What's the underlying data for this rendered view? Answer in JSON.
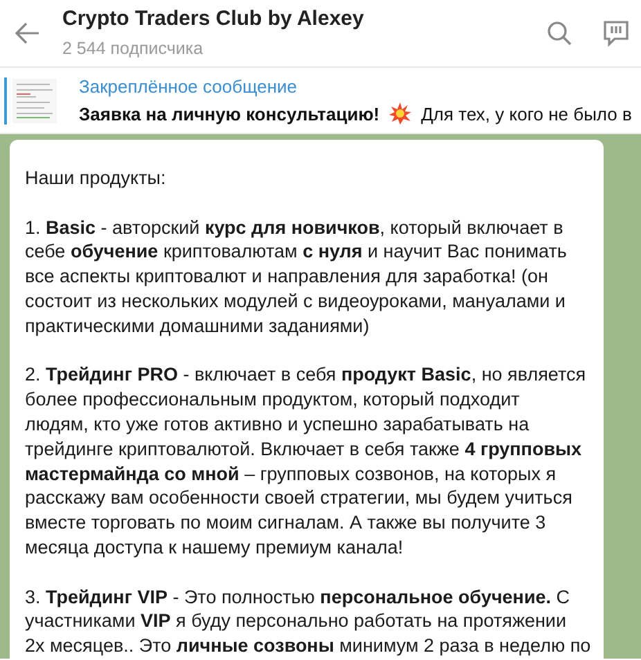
{
  "header": {
    "title": "Crypto Traders Club by Alexey",
    "subtitle": "2 544 подписчика"
  },
  "pinned": {
    "label": "Закреплённое сообщение",
    "text_bold": "Заявка на личную консультацию!",
    "text": "Для тех, у кого не было в"
  },
  "message": {
    "paragraphs": [
      {
        "lines": [
          "Наши продукты:"
        ]
      },
      {
        "lines": [
          "1. **Basic** - авторский **курс для новичков**, который включает в",
          "себе **обучение** криптовалютам **с нуля** и научит Вас понимать",
          "все аспекты криптовалют и направления для заработка! (он",
          "состоит из нескольких модулей с видеоуроками, мануалами и",
          "практическими домашними заданиями)"
        ]
      },
      {
        "lines": [
          "2. **Трейдинг PRO** - включает в себя **продукт Basic**, но является",
          "более профессиональным продуктом, который подходит",
          "людям, кто уже готов активно и успешно зарабатывать на",
          "трейдинге криптовалютой. Включает в себя также **4 групповых**",
          "**мастермайнда со мной** – групповых созвонов, на которых я",
          "расскажу вам особенности своей стратегии, мы будем учиться",
          "вместе торговать по моим сигналам. А также вы получите 3",
          "месяца доступа к нашему премиум канала!"
        ]
      },
      {
        "lines": [
          "3. **Трейдинг VIP** - Это полностью **персональное обучение.** С",
          "участниками **VIP** я буду персонально работать на протяжении",
          "2х месяцев.. Это **личные созвоны** минимум 2 раза в неделю по"
        ]
      }
    ]
  }
}
